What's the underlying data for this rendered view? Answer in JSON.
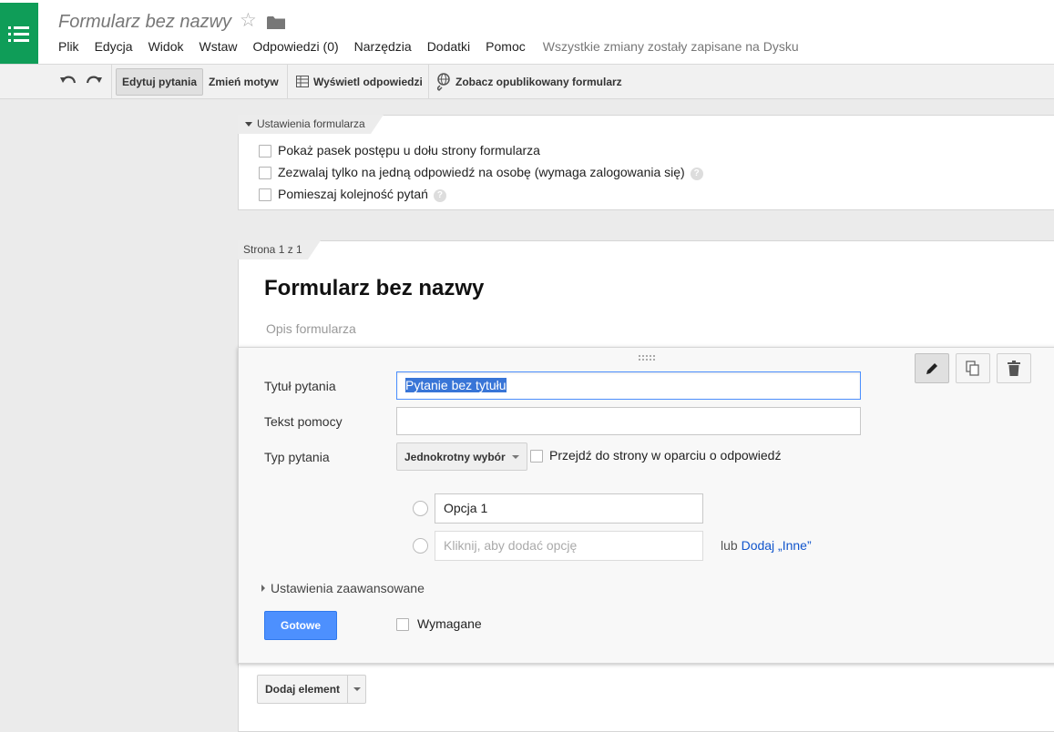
{
  "app": {
    "doc_title": "Formularz bez nazwy",
    "menu": [
      "Plik",
      "Edycja",
      "Widok",
      "Wstaw",
      "Odpowiedzi (0)",
      "Narzędzia",
      "Dodatki",
      "Pomoc"
    ],
    "save_status": "Wszystkie zmiany zostały zapisane na Dysku",
    "brand_color": "#0f9d58"
  },
  "toolbar": {
    "edit_questions": "Edytuj pytania",
    "change_theme": "Zmień motyw",
    "view_responses": "Wyświetl odpowiedzi",
    "view_published": "Zobacz opublikowany formularz"
  },
  "settings": {
    "header": "Ustawienia formularza",
    "options": [
      {
        "label": "Pokaż pasek postępu u dołu strony formularza",
        "checked": false,
        "help": false
      },
      {
        "label": "Zezwalaj tylko na jedną odpowiedź na osobę (wymaga zalogowania się)",
        "checked": false,
        "help": true
      },
      {
        "label": "Pomieszaj kolejność pytań",
        "checked": false,
        "help": true
      }
    ],
    "help_glyph": "?"
  },
  "page": {
    "header": "Strona 1 z 1",
    "form_title": "Formularz bez nazwy",
    "form_description_placeholder": "Opis formularza"
  },
  "question": {
    "title_label": "Tytuł pytania",
    "title_value": "Pytanie bez tytułu",
    "help_label": "Tekst pomocy",
    "help_value": "",
    "type_label": "Typ pytania",
    "type_value": "Jednokrotny wybór",
    "page_nav_label": "Przejdź do strony w oparciu o odpowiedź",
    "option1": "Opcja 1",
    "add_option_placeholder": "Kliknij, aby dodać opcję",
    "or_text": "lub",
    "add_other": "Dodaj „Inne”",
    "advanced": "Ustawienia zaawansowane",
    "done": "Gotowe",
    "required": "Wymagane",
    "accent_color": "#4d90fe"
  },
  "footer": {
    "add_item": "Dodaj element"
  }
}
